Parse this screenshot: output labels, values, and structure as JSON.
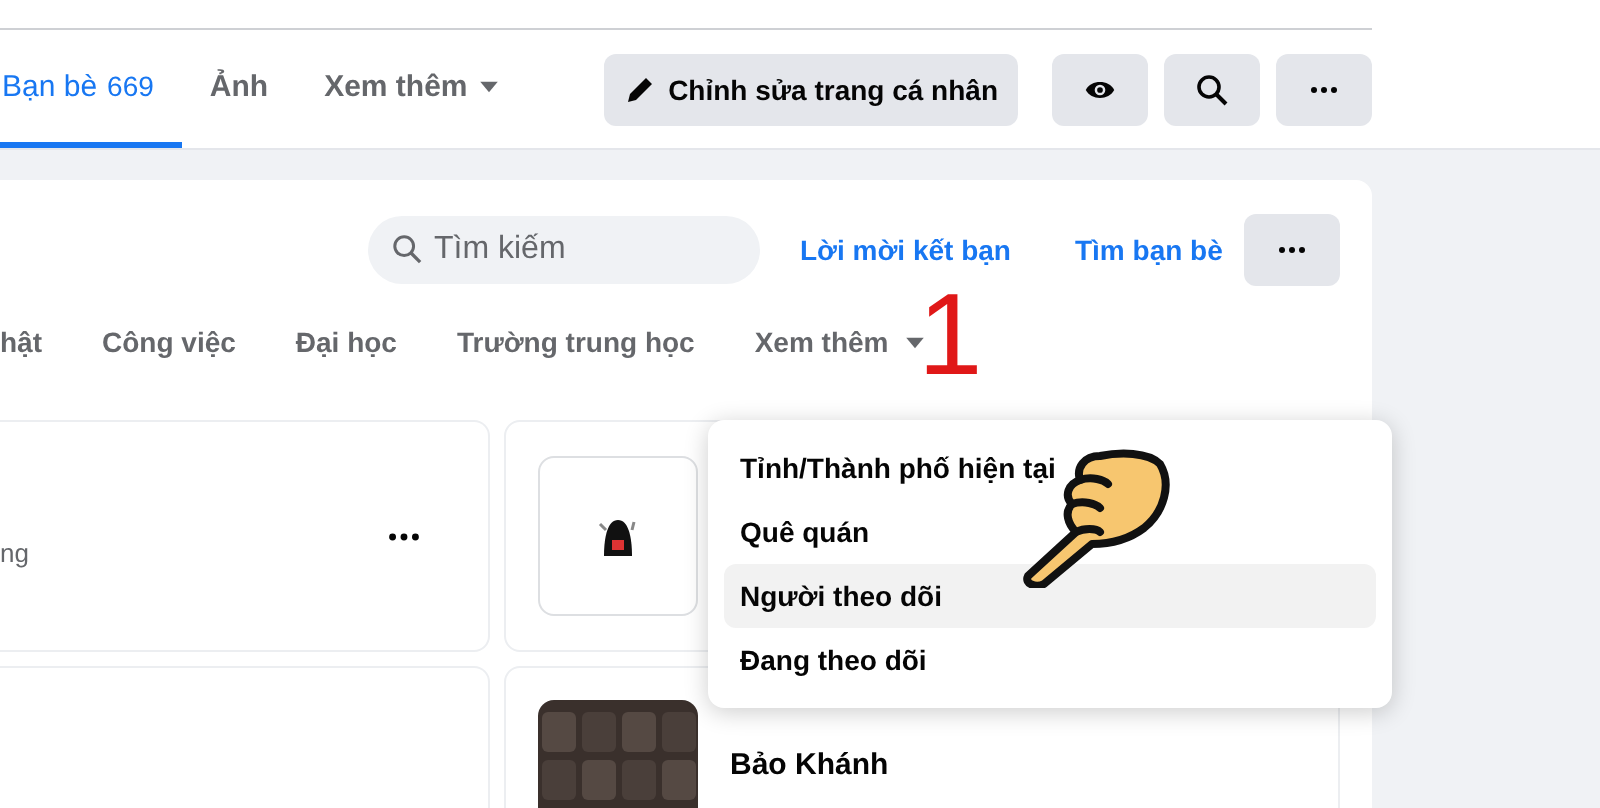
{
  "profile_tabs": [
    {
      "label": "Bạn bè",
      "count": "669",
      "selected": true,
      "kind": "plain"
    },
    {
      "label": "Ảnh",
      "selected": false,
      "kind": "plain"
    },
    {
      "label": "Xem thêm",
      "selected": false,
      "kind": "dropdown"
    }
  ],
  "profile_actions": [
    {
      "kind": "edit",
      "label": "Chỉnh sửa trang cá nhân"
    },
    {
      "kind": "eye"
    },
    {
      "kind": "search"
    },
    {
      "kind": "more"
    }
  ],
  "friends_panel": {
    "search": {
      "placeholder": "Tìm kiếm"
    },
    "links": [
      "Lời mời kết bạn",
      "Tìm bạn bè"
    ],
    "filter_tabs": [
      {
        "label": "hật",
        "kind": "plain"
      },
      {
        "label": "Công việc",
        "kind": "plain"
      },
      {
        "label": "Đại học",
        "kind": "plain"
      },
      {
        "label": "Trường trung học",
        "kind": "plain"
      },
      {
        "label": "Xem thêm",
        "kind": "dropdown"
      }
    ],
    "friends": [
      {
        "kind": "text",
        "subtitle": "ng"
      },
      {
        "kind": "sticker"
      },
      {
        "kind": "blank"
      },
      {
        "name": "Bảo Khánh"
      }
    ]
  },
  "dropdown": {
    "items": [
      {
        "label": "Tỉnh/Thành phố hiện tại",
        "selected": false
      },
      {
        "label": "Quê quán",
        "selected": false
      },
      {
        "label": "Người theo dõi",
        "selected": true
      },
      {
        "label": "Đang theo dõi",
        "selected": false
      }
    ]
  },
  "annotation": {
    "step": "1"
  }
}
